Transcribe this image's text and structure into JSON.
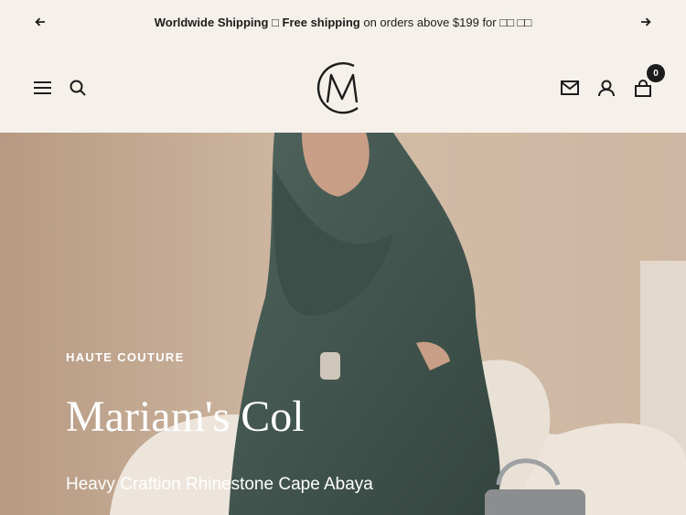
{
  "announcement": {
    "bold_1": "Worldwide Shipping",
    "sep": " □ ",
    "bold_2": "Free shipping",
    "rest": " on orders above $199 for ",
    "tail": "□□ □□",
    "prev_icon": "arrow-left-icon",
    "next_icon": "arrow-right-icon"
  },
  "header": {
    "menu_icon": "hamburger-menu-icon",
    "search_icon": "search-icon",
    "logo_icon": "m-monogram-logo",
    "mail_icon": "envelope-icon",
    "account_icon": "user-icon",
    "cart_icon": "shopping-bag-icon",
    "cart_count": "0"
  },
  "hero": {
    "eyebrow": "HAUTE COUTURE",
    "title": "Mariam's Col",
    "subtitle": "Heavy Craftion Rhinestone Cape Abaya"
  },
  "colors": {
    "header_bg": "#f5f0ea",
    "text": "#1c1c1c",
    "hero_text": "#ffffff",
    "garment": "#3f524c"
  }
}
